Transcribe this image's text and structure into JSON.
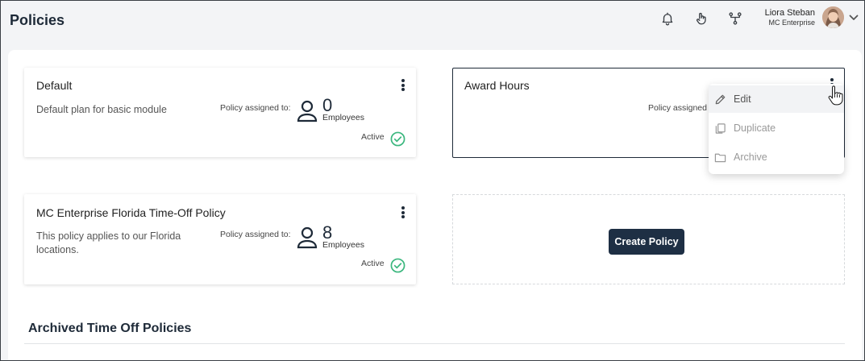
{
  "header": {
    "title": "Policies",
    "icons": [
      "bell-icon",
      "touch-icon",
      "hierarchy-icon",
      "chevron-down-icon"
    ],
    "user": {
      "name": "Liora Steban",
      "org": "MC Enterprise"
    }
  },
  "cards": [
    {
      "title": "Default",
      "description": "Default plan for basic module",
      "assigned_label": "Policy assigned to:",
      "count": "0",
      "count_unit": "Employees",
      "status": "Active"
    },
    {
      "title": "Award Hours",
      "assigned_label": "Policy assigned"
    },
    {
      "title": "MC Enterprise Florida Time-Off Policy",
      "description": "This policy applies to our Florida locations.",
      "assigned_label": "Policy assigned to:",
      "count": "8",
      "count_unit": "Employees",
      "status": "Active"
    }
  ],
  "create_button": "Create Policy",
  "archived_section_title": "Archived Time Off Policies",
  "menu": {
    "items": [
      {
        "label": "Edit",
        "icon": "pencil-icon",
        "state": "hovered"
      },
      {
        "label": "Duplicate",
        "icon": "copy-icon"
      },
      {
        "label": "Archive",
        "icon": "folder-icon"
      }
    ]
  },
  "colors": {
    "primary": "#1e2f44",
    "active_green": "#3bb77e",
    "page_bg": "#f3f4f6"
  }
}
